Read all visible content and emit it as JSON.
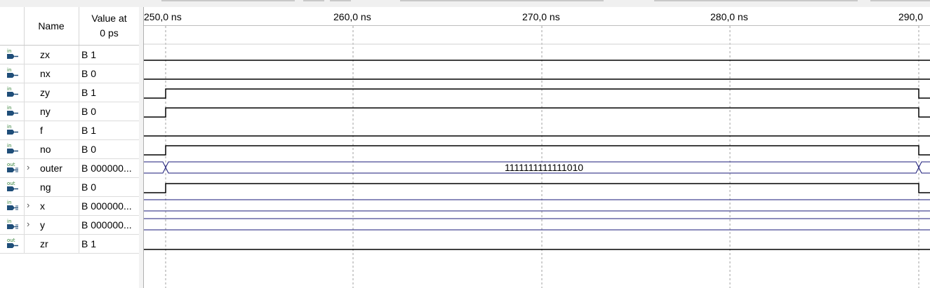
{
  "header": {
    "name_label": "Name",
    "value_label_line1": "Value at",
    "value_label_line2": "0 ps"
  },
  "timeline": {
    "labels": [
      "250,0 ns",
      "260,0 ns",
      "270,0 ns",
      "280,0 ns",
      "290,0"
    ]
  },
  "signals": [
    {
      "name": "zx",
      "value": "B 1",
      "direction": "in",
      "icon": "input-pin-icon",
      "expandable": false
    },
    {
      "name": "nx",
      "value": "B 0",
      "direction": "in",
      "icon": "input-pin-icon",
      "expandable": false
    },
    {
      "name": "zy",
      "value": "B 1",
      "direction": "in",
      "icon": "input-pin-icon",
      "expandable": false
    },
    {
      "name": "ny",
      "value": "B 0",
      "direction": "in",
      "icon": "input-pin-icon",
      "expandable": false
    },
    {
      "name": "f",
      "value": "B 1",
      "direction": "in",
      "icon": "input-pin-icon",
      "expandable": false
    },
    {
      "name": "no",
      "value": "B 0",
      "direction": "in",
      "icon": "input-pin-icon",
      "expandable": false
    },
    {
      "name": "outer",
      "value": "B 000000...",
      "direction": "out",
      "icon": "output-bus-icon",
      "expandable": true
    },
    {
      "name": "ng",
      "value": "B 0",
      "direction": "out",
      "icon": "output-pin-icon",
      "expandable": false
    },
    {
      "name": "x",
      "value": "B 000000...",
      "direction": "in",
      "icon": "input-bus-icon",
      "expandable": true
    },
    {
      "name": "y",
      "value": "B 000000...",
      "direction": "in",
      "icon": "input-bus-icon",
      "expandable": true
    },
    {
      "name": "zr",
      "value": "B 1",
      "direction": "out",
      "icon": "output-pin-icon",
      "expandable": false
    }
  ],
  "waveforms": {
    "outer_bus_value": "1111111111111010"
  },
  "colors": {
    "bus": "#1a1a7a",
    "grid": "#a0a0a0",
    "icon_blue": "#1f4e79",
    "icon_label_green": "#2e7d32"
  }
}
